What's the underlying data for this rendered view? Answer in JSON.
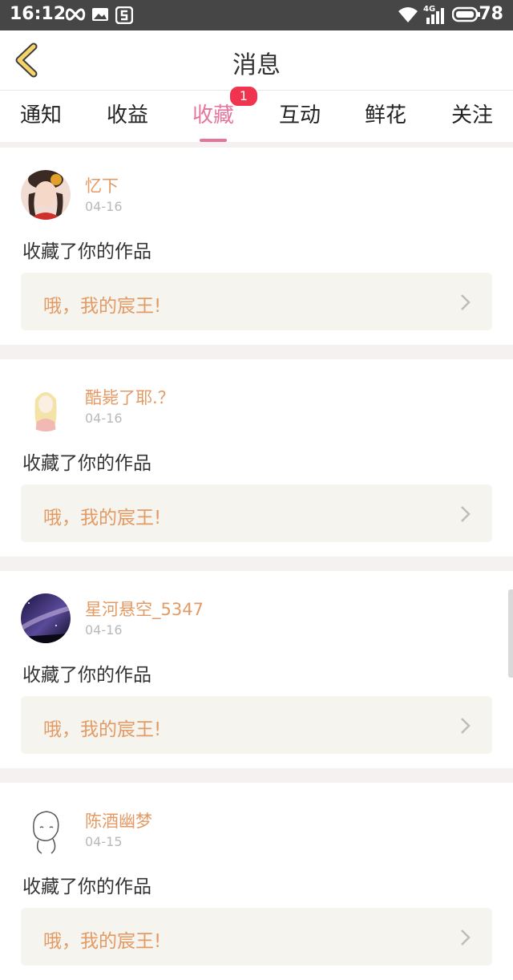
{
  "status_bar": {
    "time": "16:12",
    "battery": "78",
    "network": "4G",
    "icons": [
      "infinity-icon",
      "image-icon",
      "s-app-icon",
      "wifi-icon",
      "signal-icon",
      "battery-icon"
    ]
  },
  "header": {
    "title": "消息",
    "back_icon": "chevron-left-icon",
    "accent": "#f5d36b"
  },
  "tabs": [
    {
      "label": "通知"
    },
    {
      "label": "收益"
    },
    {
      "label": "收藏",
      "active": true,
      "badge": "1"
    },
    {
      "label": "互动"
    },
    {
      "label": "鲜花"
    },
    {
      "label": "关注"
    }
  ],
  "colors": {
    "active_tab": "#e4759d",
    "username": "#e39a64",
    "badge": "#f0334f"
  },
  "messages": [
    {
      "username": "忆下",
      "date": "04-16",
      "action": "收藏了你的作品",
      "work_title": "哦，我的宸王!",
      "avatar_icon": "girl-photo-avatar"
    },
    {
      "username": "酷毙了耶.？",
      "date": "04-16",
      "action": "收藏了你的作品",
      "work_title": "哦，我的宸王!",
      "avatar_icon": "anime-girl-avatar"
    },
    {
      "username": "星河悬空_5347",
      "date": "04-16",
      "action": "收藏了你的作品",
      "work_title": "哦，我的宸王!",
      "avatar_icon": "night-sky-avatar"
    },
    {
      "username": "陈酒幽梦",
      "date": "04-15",
      "action": "收藏了你的作品",
      "work_title": "哦，我的宸王!",
      "avatar_icon": "sketch-avatar"
    }
  ]
}
